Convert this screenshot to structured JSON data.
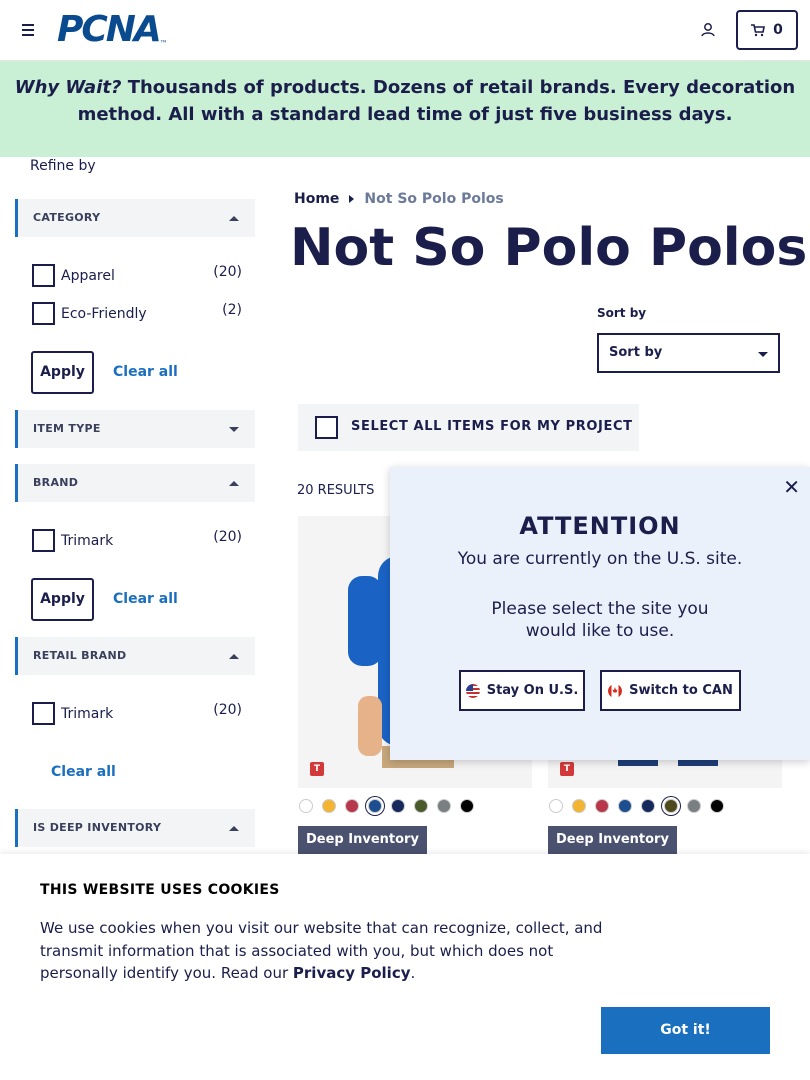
{
  "header": {
    "logo_text": "PCNA",
    "logo_tm": "™",
    "cart_count": "0"
  },
  "banner": {
    "lead": "Why Wait?",
    "text": " Thousands of products. Dozens of retail brands. Every decoration method. All with a standard lead time of just five business days."
  },
  "sidebar": {
    "refine_label": "Refine by",
    "category": {
      "title": "CATEGORY",
      "options": [
        {
          "label": "Apparel",
          "count": "(20)"
        },
        {
          "label": "Eco-Friendly",
          "count": "(2)"
        }
      ],
      "apply": "Apply",
      "clear": "Clear all"
    },
    "item_type": {
      "title": "ITEM TYPE"
    },
    "brand": {
      "title": "BRAND",
      "options": [
        {
          "label": "Trimark",
          "count": "(20)"
        }
      ],
      "apply": "Apply",
      "clear": "Clear all"
    },
    "retail_brand": {
      "title": "RETAIL BRAND",
      "options": [
        {
          "label": "Trimark",
          "count": "(20)"
        }
      ],
      "clear": "Clear all"
    },
    "deep_inventory": {
      "title": "IS DEEP INVENTORY"
    }
  },
  "main": {
    "breadcrumb": {
      "home": "Home",
      "current": "Not So Polo Polos"
    },
    "title": "Not So Polo Polos",
    "sort_label": "Sort by",
    "sort_value": "Sort by",
    "select_all": "SELECT ALL ITEMS FOR MY PROJECT",
    "results": "20 RESULTS",
    "products": [
      {
        "brand_badge": "T",
        "badge": "Deep Inventory",
        "swatches": [
          "#ffffff",
          "#f2b431",
          "#b8374a",
          "#1d4e8f",
          "#16285c",
          "#4a5a2a",
          "#7a7f82",
          "#000000"
        ],
        "selected_swatch": 3
      },
      {
        "brand_badge": "T",
        "badge": "Deep Inventory",
        "swatches": [
          "#ffffff",
          "#f2b431",
          "#b8374a",
          "#1d4e8f",
          "#16285c",
          "#4f4a1e",
          "#7a7f82",
          "#000000"
        ],
        "selected_swatch": 5
      }
    ]
  },
  "modal": {
    "title": "ATTENTION",
    "line1": "You are currently on the U.S. site.",
    "line2": "Please select the site you",
    "line3": "would like to use.",
    "stay": "Stay On U.S.",
    "switch": "Switch to CAN"
  },
  "cookie": {
    "title": "THIS WEBSITE USES COOKIES",
    "text": "We use cookies when you visit our website that can recognize, collect, and transmit information that is associated with you, but which does not personally identify you. Read our ",
    "link": "Privacy Policy",
    "end": ".",
    "button": "Got it!"
  }
}
